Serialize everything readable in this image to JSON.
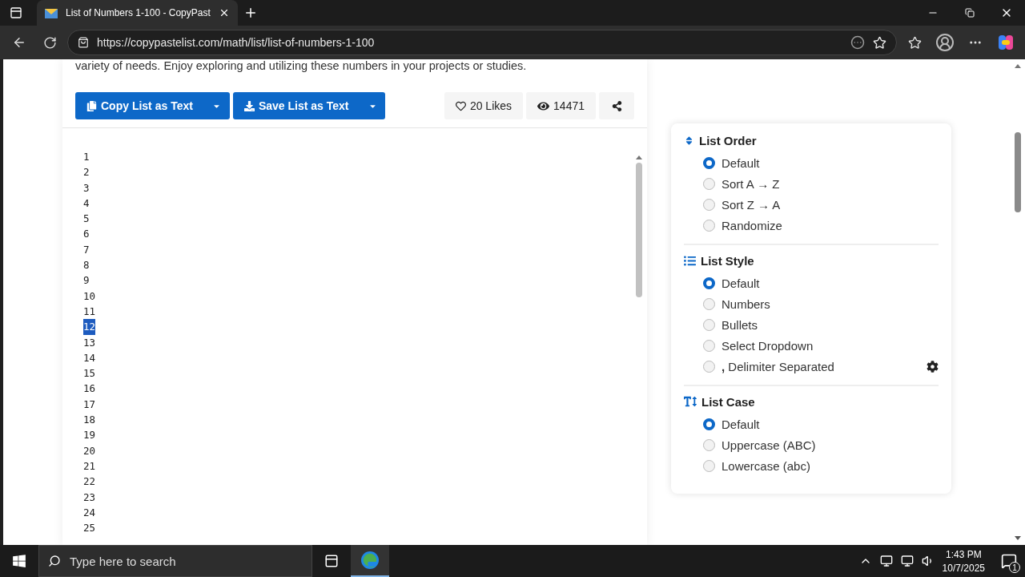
{
  "browser": {
    "tab_title": "List of Numbers 1-100 - CopyPast",
    "url": "https://copypastelist.com/math/list/list-of-numbers-1-100"
  },
  "intro": "variety of needs. Enjoy exploring and utilizing these numbers in your projects or studies.",
  "actions": [
    {
      "label": "Copy List as Text",
      "kind": "copy"
    },
    {
      "label": "Save List as Text",
      "kind": "save"
    }
  ],
  "stats": {
    "likes": "20 Likes",
    "views": "14471"
  },
  "list_items": [
    {
      "text": "1",
      "selected": false
    },
    {
      "text": "2",
      "selected": false
    },
    {
      "text": "3",
      "selected": false
    },
    {
      "text": "4",
      "selected": false
    },
    {
      "text": "5",
      "selected": false
    },
    {
      "text": "6",
      "selected": false
    },
    {
      "text": "7",
      "selected": false
    },
    {
      "text": "8",
      "selected": false
    },
    {
      "text": "9",
      "selected": false
    },
    {
      "text": "10",
      "selected": false
    },
    {
      "text": "11",
      "selected": false
    },
    {
      "text": "12",
      "selected": true
    },
    {
      "text": "13",
      "selected": false
    },
    {
      "text": "14",
      "selected": false
    },
    {
      "text": "15",
      "selected": false
    },
    {
      "text": "16",
      "selected": false
    },
    {
      "text": "17",
      "selected": false
    },
    {
      "text": "18",
      "selected": false
    },
    {
      "text": "19",
      "selected": false
    },
    {
      "text": "20",
      "selected": false
    },
    {
      "text": "21",
      "selected": false
    },
    {
      "text": "22",
      "selected": false
    },
    {
      "text": "23",
      "selected": false
    },
    {
      "text": "24",
      "selected": false
    },
    {
      "text": "25",
      "selected": false
    }
  ],
  "options_panel": [
    {
      "title": "List Order",
      "kind": "order",
      "options": [
        {
          "label": "Default",
          "selected": true,
          "kind": "plain"
        },
        {
          "label": "Sort A → Z",
          "selected": false,
          "kind": "plain"
        },
        {
          "label": "Sort Z → A",
          "selected": false,
          "kind": "plain"
        },
        {
          "label": "Randomize",
          "selected": false,
          "kind": "plain"
        }
      ]
    },
    {
      "title": "List Style",
      "kind": "style",
      "options": [
        {
          "label": "Default",
          "selected": true,
          "kind": "plain"
        },
        {
          "label": "Numbers",
          "selected": false,
          "kind": "plain"
        },
        {
          "label": "Bullets",
          "selected": false,
          "kind": "plain"
        },
        {
          "label": "Select Dropdown",
          "selected": false,
          "kind": "plain"
        },
        {
          "label": "**,** Delimiter Separated",
          "selected": false,
          "kind": "with-settings"
        }
      ]
    },
    {
      "title": "List Case",
      "kind": "case",
      "options": [
        {
          "label": "Default",
          "selected": true,
          "kind": "plain"
        },
        {
          "label": "Uppercase (ABC)",
          "selected": false,
          "kind": "plain"
        },
        {
          "label": "Lowercase (abc)",
          "selected": false,
          "kind": "plain"
        }
      ]
    }
  ],
  "taskbar": {
    "search_placeholder": "Type here to search",
    "time": "1:43 PM",
    "date": "10/7/2025",
    "notification_count": "1"
  }
}
